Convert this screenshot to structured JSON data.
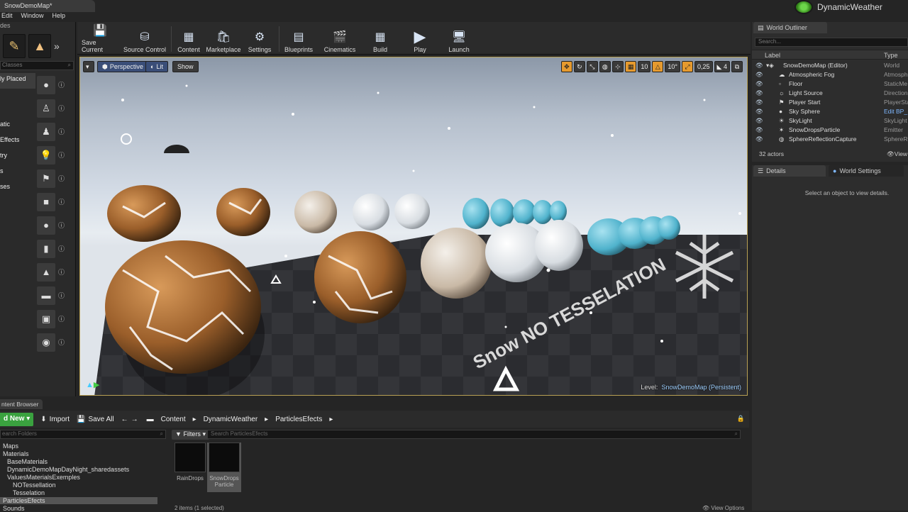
{
  "app": {
    "tab_title": "SnowDemoMap*",
    "menu": [
      "Edit",
      "Window",
      "Help"
    ],
    "project_name": "DynamicWeather",
    "modes_label": "des"
  },
  "modes": {
    "search_placeholder": "Classes",
    "categories": [
      "ly Placed",
      "",
      "atic",
      "Effects",
      "try",
      "s",
      "ses"
    ],
    "place_icons": [
      "sphere-icon",
      "pillar-icon",
      "pawn-icon",
      "point-light-icon",
      "player-start-icon",
      "cube-icon",
      "sphere-shape-icon",
      "cylinder-icon",
      "cone-icon",
      "plane-icon",
      "box-volume-icon",
      "sphere-volume-icon"
    ]
  },
  "toolbar": {
    "buttons": [
      {
        "label": "Save Current",
        "icon": "save-icon"
      },
      {
        "label": "Source Control",
        "icon": "source-control-icon"
      },
      {
        "label": "Content",
        "icon": "content-icon"
      },
      {
        "label": "Marketplace",
        "icon": "marketplace-icon"
      },
      {
        "label": "Settings",
        "icon": "settings-icon"
      },
      {
        "label": "Blueprints",
        "icon": "blueprints-icon"
      },
      {
        "label": "Cinematics",
        "icon": "cinematics-icon"
      },
      {
        "label": "Build",
        "icon": "build-icon"
      },
      {
        "label": "Play",
        "icon": "play-icon"
      },
      {
        "label": "Launch",
        "icon": "launch-icon"
      }
    ]
  },
  "viewport": {
    "perspective": "Perspective",
    "lit": "Lit",
    "show": "Show",
    "grid_snap": "10",
    "rot_snap": "10°",
    "scale_snap": "0,25",
    "cam_speed": "4",
    "level_label": "Level:",
    "level_name": "SnowDemoMap (Persistent)",
    "floor_text": "Snow NO TESSELATION"
  },
  "outliner": {
    "title": "World Outliner",
    "search_placeholder": "Search...",
    "col_label": "Label",
    "col_type": "Type",
    "rows": [
      {
        "label": "SnowDemoMap (Editor)",
        "type": "World"
      },
      {
        "label": "Atmospheric Fog",
        "type": "Atmosph"
      },
      {
        "label": "Floor",
        "type": "StaticMe"
      },
      {
        "label": "Light Source",
        "type": "Direction"
      },
      {
        "label": "Player Start",
        "type": "PlayerSta"
      },
      {
        "label": "Sky Sphere",
        "type": "Edit BP_"
      },
      {
        "label": "SkyLight",
        "type": "SkyLight"
      },
      {
        "label": "SnowDropsParticle",
        "type": "Emitter"
      },
      {
        "label": "SphereReflectionCapture",
        "type": "SphereRe"
      }
    ],
    "count": "32 actors",
    "view": "View"
  },
  "details": {
    "tab1": "Details",
    "tab2": "World Settings",
    "empty_msg": "Select an object to view details."
  },
  "content_browser": {
    "tab": "ntent Browser",
    "add_new": "d New",
    "import": "Import",
    "save_all": "Save All",
    "path": [
      "Content",
      "DynamicWeather",
      "ParticlesEfects"
    ],
    "folder_search": "earch Folders",
    "folders": [
      "Maps",
      "Materials",
      "BaseMaterials",
      "DynamicDemoMapDayNight_sharedassets",
      "ValuesMaterialsExemples",
      "NOTessellation",
      "Tesselation",
      "ParticlesEfects",
      "Sounds"
    ],
    "filters": "Filters",
    "asset_search": "Search ParticlesEfects",
    "assets": [
      {
        "name": "RainDrops"
      },
      {
        "name": "SnowDrops Particle"
      }
    ],
    "status": "2 items (1 selected)",
    "view_options": "View Options"
  },
  "colors": {
    "accent_gold": "#b8a054",
    "add_new_green": "#3aa23f",
    "snap_orange": "#e69a2e"
  }
}
